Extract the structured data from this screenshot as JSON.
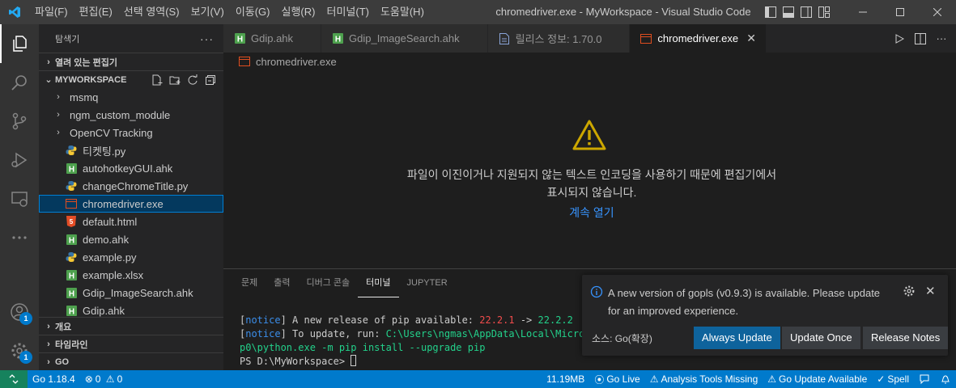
{
  "window": {
    "title": "chromedriver.exe - MyWorkspace - Visual Studio Code",
    "menu": [
      "파일(F)",
      "편집(E)",
      "선택 영역(S)",
      "보기(V)",
      "이동(G)",
      "실행(R)",
      "터미널(T)",
      "도움말(H)"
    ]
  },
  "activity_bar": {
    "accounts_badge": "1",
    "manage_badge": "1"
  },
  "sidebar": {
    "title": "탐색기",
    "more": "···",
    "open_editors": "열려 있는 편집기",
    "workspace": "MYWORKSPACE",
    "tree": [
      {
        "label": "msmq",
        "type": "folder"
      },
      {
        "label": "ngm_custom_module",
        "type": "folder"
      },
      {
        "label": "OpenCV Tracking",
        "type": "folder"
      },
      {
        "label": "티켓팅.py",
        "type": "python"
      },
      {
        "label": "autohotkeyGUI.ahk",
        "type": "ahk"
      },
      {
        "label": "changeChromeTitle.py",
        "type": "python"
      },
      {
        "label": "chromedriver.exe",
        "type": "exe",
        "selected": true
      },
      {
        "label": "default.html",
        "type": "html"
      },
      {
        "label": "demo.ahk",
        "type": "ahk"
      },
      {
        "label": "example.py",
        "type": "python"
      },
      {
        "label": "example.xlsx",
        "type": "excel"
      },
      {
        "label": "Gdip_ImageSearch.ahk",
        "type": "ahk"
      },
      {
        "label": "Gdip.ahk",
        "type": "ahk"
      }
    ],
    "sections": [
      "개요",
      "타임라인",
      "GO"
    ]
  },
  "tabs": [
    {
      "label": "Gdip.ahk",
      "type": "ahk"
    },
    {
      "label": "Gdip_ImageSearch.ahk",
      "type": "ahk"
    },
    {
      "label": "릴리스 정보: 1.70.0",
      "type": "doc"
    },
    {
      "label": "chromedriver.exe",
      "type": "exe",
      "active": true
    }
  ],
  "breadcrumb": "chromedriver.exe",
  "editor": {
    "message": "파일이 이진이거나 지원되지 않는 텍스트 인코딩을 사용하기 때문에 편집기에서 표시되지 않습니다.",
    "open_anyway": "계속 열기"
  },
  "panel": {
    "tabs": [
      "문제",
      "출력",
      "디버그 콘솔",
      "터미널",
      "JUPYTER"
    ],
    "active_tab": "터미널",
    "terminal": {
      "line1_notice": "notice",
      "line1_text": " A new release of pip available: ",
      "line1_old": "22.2.1",
      "line1_arrow": " -> ",
      "line1_new": "22.2.2",
      "line2_notice": "notice",
      "line2_text": " To update, run: ",
      "line2_cmd": "C:\\Users\\ngmas\\AppData\\Local\\Microso",
      "line3": "p0\\python.exe -m pip install --upgrade pip",
      "prompt": "PS D:\\MyWorkspace> "
    }
  },
  "notification": {
    "message": "A new version of gopls (v0.9.3) is available. Please update for an improved experience.",
    "source": "소스: Go(확장)",
    "buttons": [
      "Always Update",
      "Update Once",
      "Release Notes"
    ]
  },
  "status_bar": {
    "go_version": "Go 1.18.4",
    "errors": "0",
    "warnings": "0",
    "memory": "11.19MB",
    "go_live": "Go Live",
    "analysis": "Analysis Tools Missing",
    "go_update": "Go Update Available",
    "spell": "Spell"
  }
}
